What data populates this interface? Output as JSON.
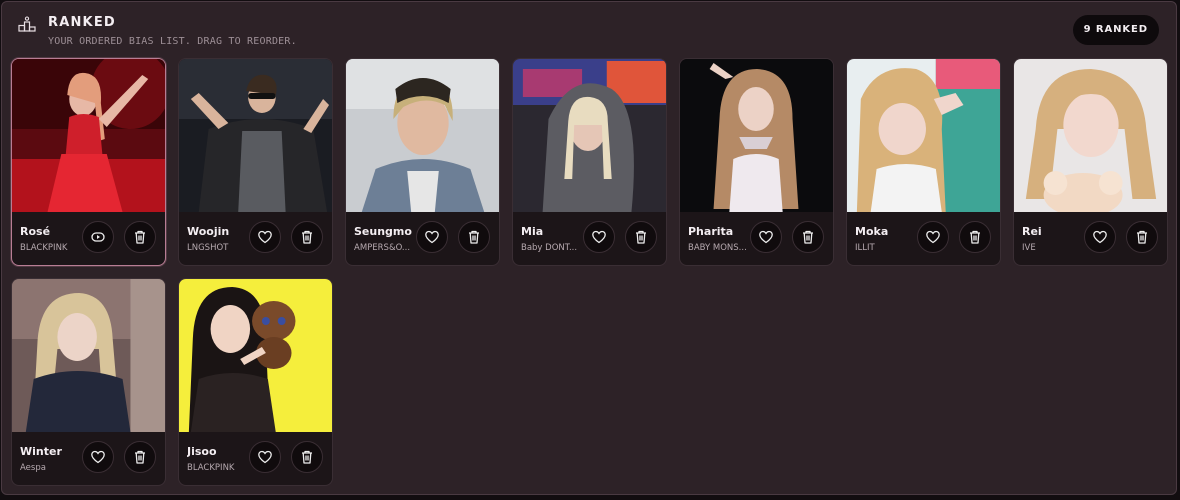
{
  "header": {
    "title": "RANKED",
    "subtitle": "YOUR ORDERED BIAS LIST. DRAG TO REORDER.",
    "count_badge": "9 RANKED",
    "icon": "podium-icon"
  },
  "cards": [
    {
      "name": "Rosé",
      "group": "BLACKPINK",
      "selected": true,
      "primary_action_icon": "reorder-icon",
      "delete_icon": "trash-icon"
    },
    {
      "name": "Woojin",
      "group": "LNGSHOT",
      "primary_action_icon": "heart-icon",
      "delete_icon": "trash-icon"
    },
    {
      "name": "Seungmo",
      "group": "AMPERS&O...",
      "primary_action_icon": "heart-icon",
      "delete_icon": "trash-icon"
    },
    {
      "name": "Mia",
      "group": "Baby DONT...",
      "primary_action_icon": "heart-icon",
      "delete_icon": "trash-icon"
    },
    {
      "name": "Pharita",
      "group": "BABY MONS...",
      "primary_action_icon": "heart-icon",
      "delete_icon": "trash-icon"
    },
    {
      "name": "Moka",
      "group": "ILLIT",
      "primary_action_icon": "heart-icon",
      "delete_icon": "trash-icon"
    },
    {
      "name": "Rei",
      "group": "IVE",
      "primary_action_icon": "heart-icon",
      "delete_icon": "trash-icon"
    },
    {
      "name": "Winter",
      "group": "Aespa",
      "primary_action_icon": "heart-icon",
      "delete_icon": "trash-icon"
    },
    {
      "name": "Jisoo",
      "group": "BLACKPINK",
      "primary_action_icon": "heart-icon",
      "delete_icon": "trash-icon"
    }
  ],
  "colors": {
    "panel_bg": "#2d2227",
    "card_bg": "#1c1518",
    "selected_border": "#b87d94",
    "badge_bg": "#0e0a0c"
  }
}
